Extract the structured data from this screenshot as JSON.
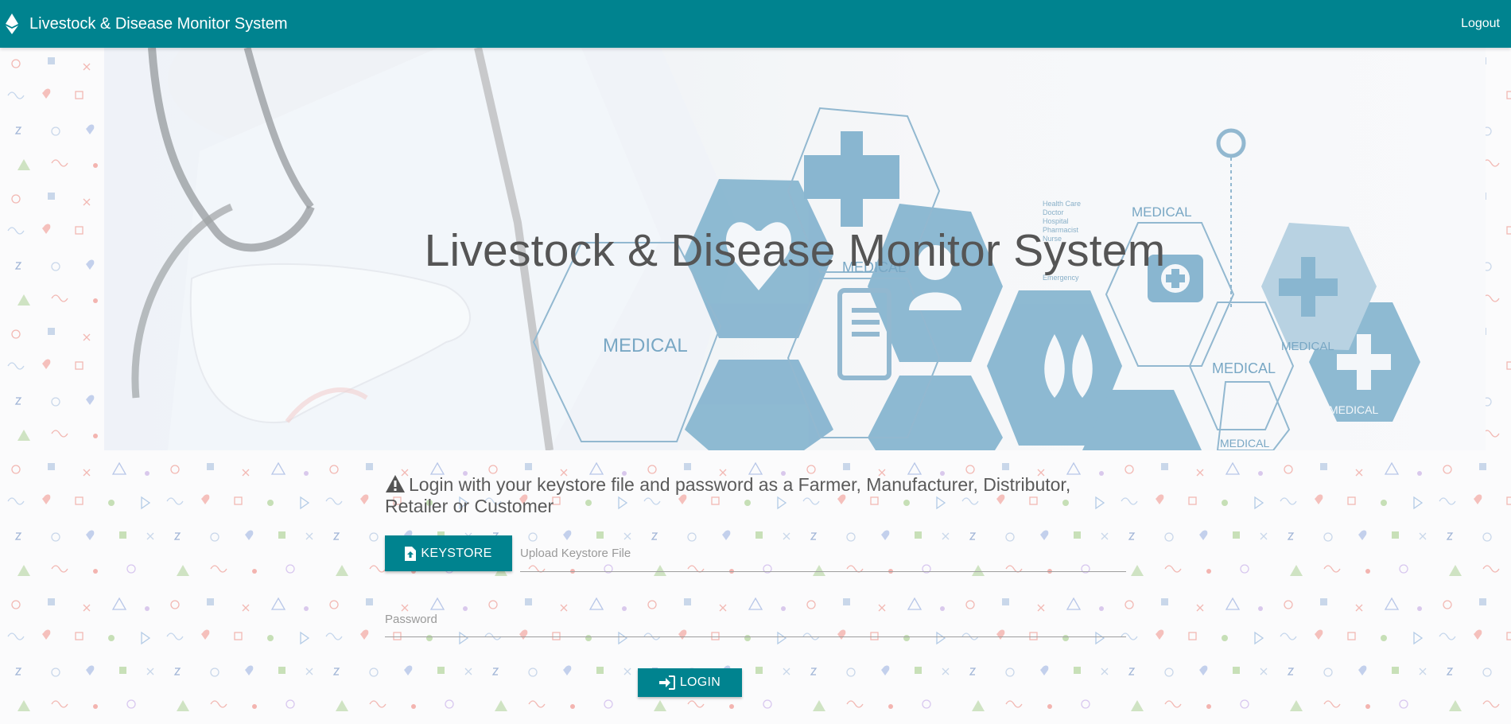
{
  "navbar": {
    "brand_icon": "ethereum-icon",
    "title": "Livestock & Disease Monitor System",
    "logout_label": "Logout"
  },
  "hero": {
    "title": "Livestock & Disease Monitor System",
    "image_labels": [
      "MEDICAL",
      "MEDICAL",
      "MEDICAL",
      "MEDICAL",
      "MEDICAL",
      "MEDICAL",
      "MEDICAL"
    ],
    "image_list": [
      "Health Care",
      "Doctor",
      "Hospital",
      "Pharmacist",
      "Nurse",
      "Emergency"
    ]
  },
  "login": {
    "warning_icon": "warning-icon",
    "instruction": "Login with your keystore file and password as a Farmer, Manufacturer, Distributor, Retailer or Customer",
    "keystore_button": "KEYSTORE",
    "keystore_icon": "file-upload-icon",
    "keystore_placeholder": "Upload Keystore File",
    "password_placeholder": "Password",
    "login_button": "LOGIN",
    "login_icon": "sign-in-icon"
  },
  "colors": {
    "primary": "#00838f",
    "hexagon": "#5b9cbf"
  }
}
